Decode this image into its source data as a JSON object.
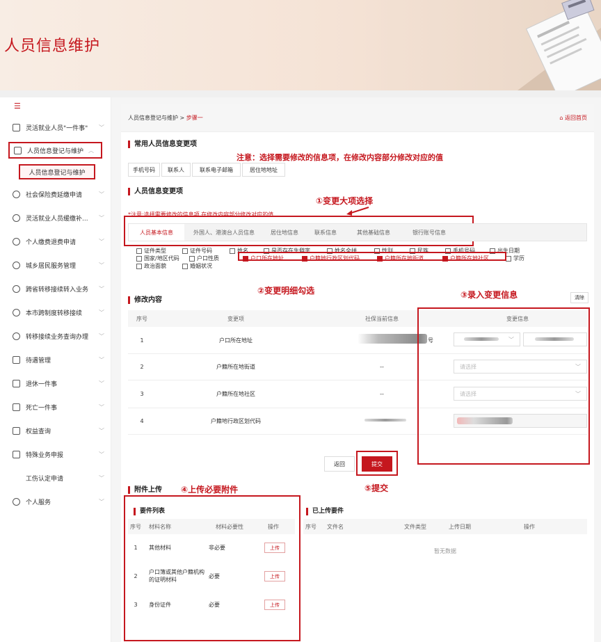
{
  "banner": {
    "title": "人员信息维护"
  },
  "sidebar": {
    "toggle_glyph": "☰",
    "items": [
      {
        "label": "灵活就业人员\"一件事\"",
        "icon": "id-card-icon"
      },
      {
        "label": "人员信息登记与维护",
        "icon": "user-card-icon"
      },
      {
        "label": "社会保险费延缴申请",
        "icon": "shield-icon"
      },
      {
        "label": "灵活就业人员缓缴补...",
        "icon": "shield-check-icon"
      },
      {
        "label": "个人缴费退费申请",
        "icon": "refund-icon"
      },
      {
        "label": "城乡居民服务管理",
        "icon": "building-icon"
      },
      {
        "label": "跨省转移接续转入业务",
        "icon": "transfer-icon"
      },
      {
        "label": "本市跨制度转移接续",
        "icon": "transfer-icon"
      },
      {
        "label": "转移接续业务查询办理",
        "icon": "search-doc-icon"
      },
      {
        "label": "待遇管理",
        "icon": "doc-icon"
      },
      {
        "label": "退休一件事",
        "icon": "doc-icon"
      },
      {
        "label": "死亡一件事",
        "icon": "doc-icon"
      },
      {
        "label": "权益查询",
        "icon": "doc-icon"
      },
      {
        "label": "特殊业务申报",
        "icon": "report-icon"
      },
      {
        "label": "工伤认定申请",
        "icon": ""
      },
      {
        "label": "个人服务",
        "icon": "person-icon"
      }
    ],
    "subitem": "人员信息登记与维护"
  },
  "breadcrumb": {
    "parent": "人员信息登记与维护",
    "sep": " > ",
    "current": "步骤一",
    "back_home": "返回首页"
  },
  "common": {
    "title": "常用人员信息变更项",
    "notice": "注意：选择需要修改的信息项，在修改内容部分修改对应的值",
    "buttons": [
      "手机号码",
      "联系人",
      "联系电子邮箱",
      "居住地地址"
    ]
  },
  "change": {
    "title": "人员信息变更项",
    "annot1": "①变更大项选择",
    "hint": "*注意:选择需要修改的信息项,在修改内容部分修改对应的值",
    "tabs": [
      "人员基本信息",
      "外国人、港澳台人员信息",
      "居住地信息",
      "联系信息",
      "其他基础信息",
      "银行账号信息"
    ],
    "row1": [
      {
        "label": "证件类型",
        "on": false
      },
      {
        "label": "证件号码",
        "on": false
      },
      {
        "label": "姓名",
        "on": false
      },
      {
        "label": "是否存在生僻字",
        "on": false
      },
      {
        "label": "姓名全拼",
        "on": false
      },
      {
        "label": "性别",
        "on": false
      },
      {
        "label": "民族",
        "on": false
      },
      {
        "label": "手机号码",
        "on": false
      },
      {
        "label": "出生日期",
        "on": false
      }
    ],
    "row2": [
      {
        "label": "国家/地区代码",
        "on": false
      },
      {
        "label": "户口性质",
        "on": false
      },
      {
        "label": "户口所在地址",
        "on": true
      },
      {
        "label": "户籍地行政区划代码",
        "on": true
      },
      {
        "label": "户籍所在地街道",
        "on": true
      },
      {
        "label": "户籍所在地社区",
        "on": true
      },
      {
        "label": "学历",
        "on": false
      }
    ],
    "row3": [
      {
        "label": "政治面貌",
        "on": false
      },
      {
        "label": "婚姻状况",
        "on": false
      }
    ],
    "annot2": "②变更明细勾选"
  },
  "modify": {
    "title": "修改内容",
    "annot3": "③录入变更信息",
    "clear": "清除",
    "headers": [
      "序号",
      "变更项",
      "社保当前信息",
      "变更信息"
    ],
    "rows": [
      {
        "no": "1",
        "item": "户口所在地址",
        "current_suffix": "号",
        "placeholder": ""
      },
      {
        "no": "2",
        "item": "户籍所在地街道",
        "current": "--",
        "placeholder": "请选择"
      },
      {
        "no": "3",
        "item": "户籍所在地社区",
        "current": "--",
        "placeholder": "请选择"
      },
      {
        "no": "4",
        "item": "户籍地行政区划代码",
        "current": "",
        "placeholder": ""
      }
    ],
    "back": "返回",
    "submit": "提交",
    "annot5": "⑤提交"
  },
  "attach": {
    "title": "附件上传",
    "annot4": "④上传必要附件",
    "req_title": "要件列表",
    "req_headers": [
      "序号",
      "材料名称",
      "材料必要性",
      "操作"
    ],
    "req_rows": [
      {
        "no": "1",
        "name": "其他材料",
        "need": "非必要",
        "op": "上传"
      },
      {
        "no": "2",
        "name": "户口簿或其他户籍机构的证明材料",
        "need": "必要",
        "op": "上传"
      },
      {
        "no": "3",
        "name": "身份证件",
        "need": "必要",
        "op": "上传"
      }
    ],
    "up_title": "已上传要件",
    "up_headers": [
      "序号",
      "文件名",
      "文件类型",
      "上传日期",
      "操作"
    ],
    "empty": "暂无数据"
  },
  "colors": {
    "accent": "#c5171e"
  }
}
